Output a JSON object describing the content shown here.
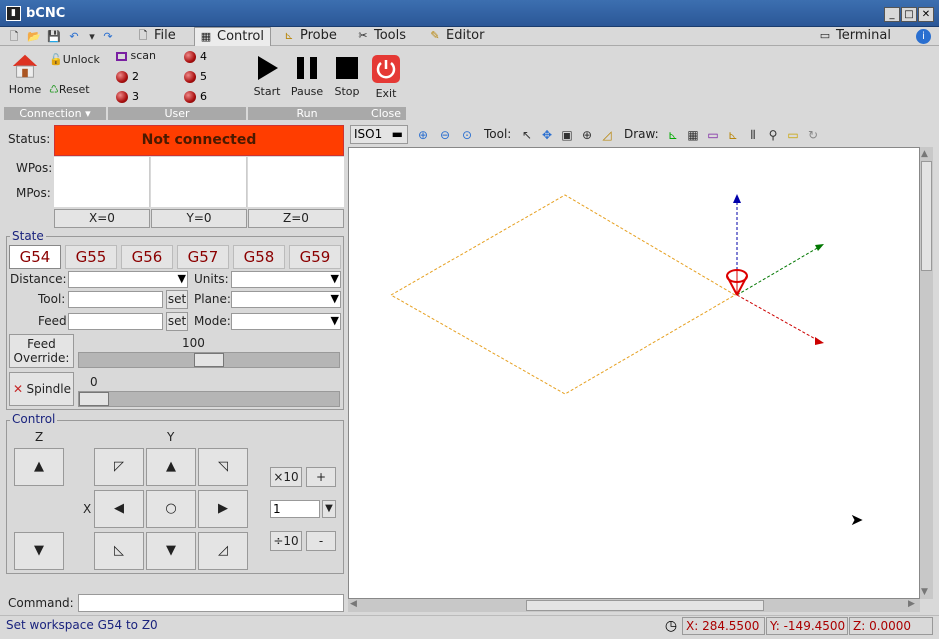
{
  "window": {
    "title": "bCNC"
  },
  "tabs": [
    {
      "label": "File"
    },
    {
      "label": "Control"
    },
    {
      "label": "Probe"
    },
    {
      "label": "Tools"
    },
    {
      "label": "Editor"
    }
  ],
  "terminal_tab": "Terminal",
  "ribbon": {
    "connection": {
      "home": "Home",
      "unlock": "Unlock",
      "reset": "Reset",
      "group": "Connection"
    },
    "user": {
      "scan": "scan",
      "b2": "2",
      "b3": "3",
      "b4": "4",
      "b5": "5",
      "b6": "6",
      "group": "User"
    },
    "run": {
      "start": "Start",
      "pause": "Pause",
      "stop": "Stop",
      "group": "Run"
    },
    "close": {
      "exit": "Exit",
      "group": "Close"
    }
  },
  "status": {
    "label": "Status:",
    "value": "Not connected",
    "color": "#ff3d00",
    "wpos": "WPos:",
    "mpos": "MPos:",
    "zero_x": "X=0",
    "zero_y": "Y=0",
    "zero_z": "Z=0"
  },
  "state": {
    "title": "State",
    "wcs": [
      "G54",
      "G55",
      "G56",
      "G57",
      "G58",
      "G59"
    ],
    "selected_wcs": "G54",
    "distance": "Distance:",
    "units": "Units:",
    "tool": "Tool:",
    "plane": "Plane:",
    "feed": "Feed:",
    "mode": "Mode:",
    "set": "set",
    "feed_override_label": "Feed Override:",
    "feed_override_value": "100",
    "feed_override_fraction": 0.5,
    "spindle_label": "Spindle",
    "spindle_value": "0",
    "spindle_fraction": 0.0
  },
  "control": {
    "title": "Control",
    "z": "Z",
    "y": "Y",
    "x": "X",
    "up": "▲",
    "down": "▼",
    "left": "◀",
    "right": "▶",
    "center": "○",
    "ul": "◸",
    "ur": "◹",
    "dl": "◺",
    "dr": "◿",
    "x10": "×10",
    "div10": "÷10",
    "plus": "+",
    "minus": "-",
    "step": "1"
  },
  "command": {
    "label": "Command:"
  },
  "canvas_toolbar": {
    "view": "ISO1",
    "tool": "Tool:",
    "draw": "Draw:"
  },
  "statusbar": {
    "message": "Set workspace G54 to Z0",
    "x": "X: 284.5500",
    "y": "Y: -149.4500",
    "z": "Z: 0.0000"
  },
  "colors": {
    "accent": "#1a237e",
    "title_bg": "#2b5797",
    "wcs_text": "#8b0000",
    "axis_x": "#cc0000",
    "axis_y": "#007700",
    "axis_z": "#0000aa",
    "workarea": "#e6a020"
  }
}
